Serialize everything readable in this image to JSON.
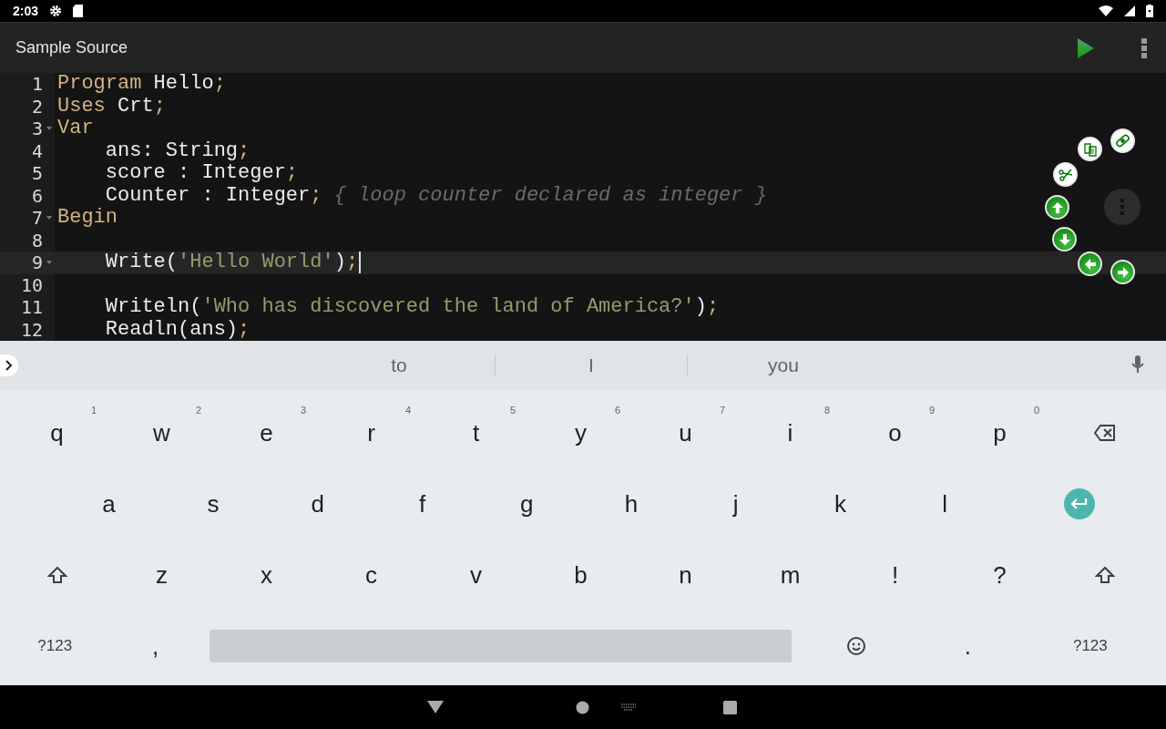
{
  "status_bar": {
    "time": "2:03"
  },
  "toolbar": {
    "title": "Sample Source"
  },
  "editor": {
    "lines": [
      {
        "number": "1",
        "foldable": false,
        "current": false,
        "tokens": [
          {
            "kind": "keyword",
            "text": "Program"
          },
          {
            "kind": "plain",
            "text": " Hello"
          },
          {
            "kind": "punct",
            "text": ";"
          }
        ]
      },
      {
        "number": "2",
        "foldable": false,
        "current": false,
        "tokens": [
          {
            "kind": "keyword",
            "text": "Uses"
          },
          {
            "kind": "plain",
            "text": " Crt"
          },
          {
            "kind": "punct",
            "text": ";"
          }
        ]
      },
      {
        "number": "3",
        "foldable": true,
        "current": false,
        "tokens": [
          {
            "kind": "keyword",
            "text": "Var"
          }
        ]
      },
      {
        "number": "4",
        "foldable": false,
        "current": false,
        "tokens": [
          {
            "kind": "plain",
            "text": "    ans: String"
          },
          {
            "kind": "punct",
            "text": ";"
          }
        ]
      },
      {
        "number": "5",
        "foldable": false,
        "current": false,
        "tokens": [
          {
            "kind": "plain",
            "text": "    score : Integer"
          },
          {
            "kind": "punct",
            "text": ";"
          }
        ]
      },
      {
        "number": "6",
        "foldable": false,
        "current": false,
        "tokens": [
          {
            "kind": "plain",
            "text": "    Counter : Integer"
          },
          {
            "kind": "punct",
            "text": ";"
          },
          {
            "kind": "comment",
            "text": " { loop counter declared as integer }"
          }
        ]
      },
      {
        "number": "7",
        "foldable": true,
        "current": false,
        "tokens": [
          {
            "kind": "keyword",
            "text": "Begin"
          }
        ]
      },
      {
        "number": "8",
        "foldable": false,
        "current": false
      },
      {
        "number": "9",
        "foldable": true,
        "current": true,
        "tokens": [
          {
            "kind": "plain",
            "text": "    Write("
          },
          {
            "kind": "string",
            "text": "'Hello World'"
          },
          {
            "kind": "plain",
            "text": ")"
          },
          {
            "kind": "punct",
            "text": ";"
          }
        ]
      },
      {
        "number": "10",
        "foldable": false,
        "current": false
      },
      {
        "number": "11",
        "foldable": false,
        "current": false,
        "tokens": [
          {
            "kind": "plain",
            "text": "    Writeln("
          },
          {
            "kind": "string",
            "text": "'Who has discovered the land of America?'"
          },
          {
            "kind": "plain",
            "text": ")"
          },
          {
            "kind": "punct",
            "text": ";"
          }
        ]
      },
      {
        "number": "12",
        "foldable": false,
        "current": false,
        "tokens": [
          {
            "kind": "plain",
            "text": "    Readln(ans)"
          },
          {
            "kind": "punct",
            "text": ";"
          }
        ]
      }
    ]
  },
  "floating_tools": [
    {
      "kind": "paste"
    },
    {
      "kind": "copy"
    },
    {
      "kind": "cut"
    },
    {
      "kind": "up"
    },
    {
      "kind": "menu"
    },
    {
      "kind": "down"
    },
    {
      "kind": "left"
    },
    {
      "kind": "right"
    }
  ],
  "keyboard": {
    "suggestions": [
      "to",
      "I",
      "you"
    ],
    "rows": [
      [
        {
          "kind": "letter",
          "label": "q",
          "hint": "1"
        },
        {
          "kind": "letter",
          "label": "w",
          "hint": "2"
        },
        {
          "kind": "letter",
          "label": "e",
          "hint": "3"
        },
        {
          "kind": "letter",
          "label": "r",
          "hint": "4"
        },
        {
          "kind": "letter",
          "label": "t",
          "hint": "5"
        },
        {
          "kind": "letter",
          "label": "y",
          "hint": "6"
        },
        {
          "kind": "letter",
          "label": "u",
          "hint": "7"
        },
        {
          "kind": "letter",
          "label": "i",
          "hint": "8"
        },
        {
          "kind": "letter",
          "label": "o",
          "hint": "9"
        },
        {
          "kind": "letter",
          "label": "p",
          "hint": "0"
        },
        {
          "kind": "backspace"
        }
      ],
      [
        {
          "kind": "letter",
          "label": "a"
        },
        {
          "kind": "letter",
          "label": "s"
        },
        {
          "kind": "letter",
          "label": "d"
        },
        {
          "kind": "letter",
          "label": "f"
        },
        {
          "kind": "letter",
          "label": "g"
        },
        {
          "kind": "letter",
          "label": "h"
        },
        {
          "kind": "letter",
          "label": "j"
        },
        {
          "kind": "letter",
          "label": "k"
        },
        {
          "kind": "letter",
          "label": "l"
        },
        {
          "kind": "enter"
        }
      ],
      [
        {
          "kind": "shift"
        },
        {
          "kind": "letter",
          "label": "z"
        },
        {
          "kind": "letter",
          "label": "x"
        },
        {
          "kind": "letter",
          "label": "c"
        },
        {
          "kind": "letter",
          "label": "v"
        },
        {
          "kind": "letter",
          "label": "b"
        },
        {
          "kind": "letter",
          "label": "n"
        },
        {
          "kind": "letter",
          "label": "m"
        },
        {
          "kind": "letter",
          "label": "!"
        },
        {
          "kind": "letter",
          "label": "?"
        },
        {
          "kind": "shift"
        }
      ],
      [
        {
          "kind": "symbol",
          "label": "?123"
        },
        {
          "kind": "letter",
          "label": ","
        },
        {
          "kind": "space"
        },
        {
          "kind": "emoji"
        },
        {
          "kind": "letter",
          "label": "."
        },
        {
          "kind": "symbol",
          "label": "?123"
        }
      ]
    ]
  }
}
